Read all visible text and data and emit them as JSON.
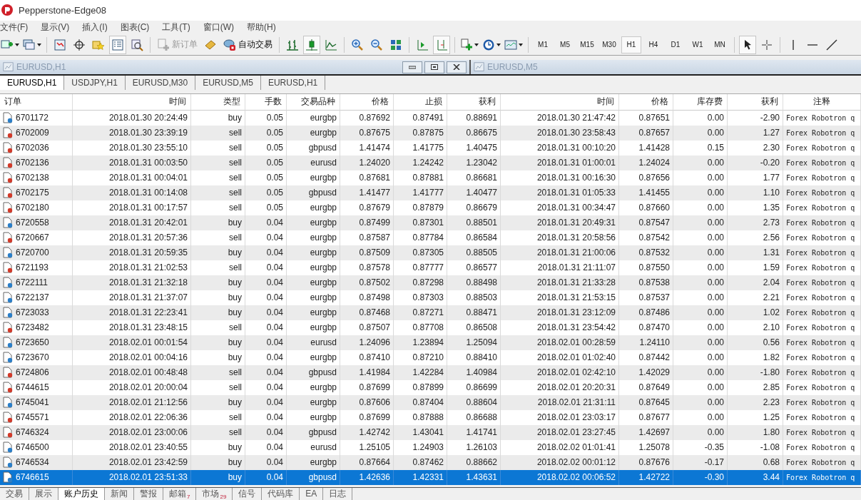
{
  "window": {
    "title": "Pepperstone-Edge08"
  },
  "menu": [
    "文件(F)",
    "显示(V)",
    "插入(I)",
    "图表(C)",
    "工具(T)",
    "窗口(W)",
    "帮助(H)"
  ],
  "toolbar": {
    "new_order": {
      "label": "新订单",
      "disabled": true
    },
    "auto_trading": {
      "label": "自动交易"
    },
    "timeframes": [
      {
        "label": "M1",
        "selected": false
      },
      {
        "label": "M5",
        "selected": false
      },
      {
        "label": "M15",
        "selected": false
      },
      {
        "label": "M30",
        "selected": false
      },
      {
        "label": "H1",
        "selected": true
      },
      {
        "label": "H4",
        "selected": false
      },
      {
        "label": "D1",
        "selected": false
      },
      {
        "label": "W1",
        "selected": false
      },
      {
        "label": "MN",
        "selected": false
      }
    ]
  },
  "minimized_windows": [
    {
      "title": "EURUSD,H1",
      "controls": true
    },
    {
      "title": "EURUSD,M5",
      "controls": false
    }
  ],
  "chart_tabs": [
    {
      "label": "EURUSD,H1",
      "selected": true
    },
    {
      "label": "USDJPY,H1",
      "selected": false
    },
    {
      "label": "EURUSD,M30",
      "selected": false
    },
    {
      "label": "EURUSD,M5",
      "selected": false
    },
    {
      "label": "EURUSD,H1",
      "selected": false
    }
  ],
  "table": {
    "columns": [
      "订单",
      "时间",
      "类型",
      "手数",
      "交易品种",
      "价格",
      "止损",
      "获利",
      "时间",
      "价格",
      "库存费",
      "获利",
      "注释"
    ],
    "rows": [
      {
        "kind": "buy",
        "selected": false,
        "cells": [
          "6701172",
          "2018.01.30 20:24:49",
          "buy",
          "0.05",
          "eurgbp",
          "0.87692",
          "0.87491",
          "0.88691",
          "2018.01.30 21:47:42",
          "0.87651",
          "0.00",
          "-2.90",
          "Forex Robotron q"
        ]
      },
      {
        "kind": "sell",
        "selected": false,
        "cells": [
          "6702009",
          "2018.01.30 23:39:19",
          "sell",
          "0.05",
          "eurgbp",
          "0.87675",
          "0.87875",
          "0.86675",
          "2018.01.30 23:58:43",
          "0.87657",
          "0.00",
          "1.27",
          "Forex Robotron q"
        ]
      },
      {
        "kind": "sell",
        "selected": false,
        "cells": [
          "6702036",
          "2018.01.30 23:55:10",
          "sell",
          "0.05",
          "gbpusd",
          "1.41474",
          "1.41775",
          "1.40475",
          "2018.01.31 00:10:20",
          "1.41428",
          "0.15",
          "2.30",
          "Forex Robotron q"
        ]
      },
      {
        "kind": "sell",
        "selected": false,
        "cells": [
          "6702136",
          "2018.01.31 00:03:50",
          "sell",
          "0.05",
          "eurusd",
          "1.24020",
          "1.24242",
          "1.23042",
          "2018.01.31 01:00:01",
          "1.24024",
          "0.00",
          "-0.20",
          "Forex Robotron q"
        ]
      },
      {
        "kind": "sell",
        "selected": false,
        "cells": [
          "6702138",
          "2018.01.31 00:04:01",
          "sell",
          "0.05",
          "eurgbp",
          "0.87681",
          "0.87881",
          "0.86681",
          "2018.01.31 00:16:30",
          "0.87656",
          "0.00",
          "1.77",
          "Forex Robotron q"
        ]
      },
      {
        "kind": "sell",
        "selected": false,
        "cells": [
          "6702175",
          "2018.01.31 00:14:08",
          "sell",
          "0.05",
          "gbpusd",
          "1.41477",
          "1.41777",
          "1.40477",
          "2018.01.31 01:05:33",
          "1.41455",
          "0.00",
          "1.10",
          "Forex Robotron q"
        ]
      },
      {
        "kind": "sell",
        "selected": false,
        "cells": [
          "6702180",
          "2018.01.31 00:17:57",
          "sell",
          "0.05",
          "eurgbp",
          "0.87679",
          "0.87879",
          "0.86679",
          "2018.01.31 00:34:47",
          "0.87660",
          "0.00",
          "1.35",
          "Forex Robotron q"
        ]
      },
      {
        "kind": "buy",
        "selected": false,
        "cells": [
          "6720558",
          "2018.01.31 20:42:01",
          "buy",
          "0.04",
          "eurgbp",
          "0.87499",
          "0.87301",
          "0.88501",
          "2018.01.31 20:49:31",
          "0.87547",
          "0.00",
          "2.73",
          "Forex Robotron q"
        ]
      },
      {
        "kind": "sell",
        "selected": false,
        "cells": [
          "6720667",
          "2018.01.31 20:57:36",
          "sell",
          "0.04",
          "eurgbp",
          "0.87587",
          "0.87784",
          "0.86584",
          "2018.01.31 20:58:56",
          "0.87542",
          "0.00",
          "2.56",
          "Forex Robotron q"
        ]
      },
      {
        "kind": "buy",
        "selected": false,
        "cells": [
          "6720700",
          "2018.01.31 20:59:35",
          "buy",
          "0.04",
          "eurgbp",
          "0.87509",
          "0.87305",
          "0.88505",
          "2018.01.31 21:00:06",
          "0.87532",
          "0.00",
          "1.31",
          "Forex Robotron q"
        ]
      },
      {
        "kind": "sell",
        "selected": false,
        "cells": [
          "6721193",
          "2018.01.31 21:02:53",
          "sell",
          "0.04",
          "eurgbp",
          "0.87578",
          "0.87777",
          "0.86577",
          "2018.01.31 21:11:07",
          "0.87550",
          "0.00",
          "1.59",
          "Forex Robotron q"
        ]
      },
      {
        "kind": "buy",
        "selected": false,
        "cells": [
          "6722111",
          "2018.01.31 21:32:18",
          "buy",
          "0.04",
          "eurgbp",
          "0.87502",
          "0.87298",
          "0.88498",
          "2018.01.31 21:33:28",
          "0.87538",
          "0.00",
          "2.04",
          "Forex Robotron q"
        ]
      },
      {
        "kind": "buy",
        "selected": false,
        "cells": [
          "6722137",
          "2018.01.31 21:37:07",
          "buy",
          "0.04",
          "eurgbp",
          "0.87498",
          "0.87303",
          "0.88503",
          "2018.01.31 21:53:15",
          "0.87537",
          "0.00",
          "2.21",
          "Forex Robotron q"
        ]
      },
      {
        "kind": "buy",
        "selected": false,
        "cells": [
          "6723033",
          "2018.01.31 22:23:41",
          "buy",
          "0.04",
          "eurgbp",
          "0.87468",
          "0.87271",
          "0.88471",
          "2018.01.31 23:12:09",
          "0.87486",
          "0.00",
          "1.02",
          "Forex Robotron q"
        ]
      },
      {
        "kind": "sell",
        "selected": false,
        "cells": [
          "6723482",
          "2018.01.31 23:48:15",
          "sell",
          "0.04",
          "eurgbp",
          "0.87507",
          "0.87708",
          "0.86508",
          "2018.01.31 23:54:42",
          "0.87470",
          "0.00",
          "2.10",
          "Forex Robotron q"
        ]
      },
      {
        "kind": "buy",
        "selected": false,
        "cells": [
          "6723650",
          "2018.02.01 00:01:54",
          "buy",
          "0.04",
          "eurusd",
          "1.24096",
          "1.23894",
          "1.25094",
          "2018.02.01 00:28:59",
          "1.24110",
          "0.00",
          "0.56",
          "Forex Robotron q"
        ]
      },
      {
        "kind": "buy",
        "selected": false,
        "cells": [
          "6723670",
          "2018.02.01 00:04:16",
          "buy",
          "0.04",
          "eurgbp",
          "0.87410",
          "0.87210",
          "0.88410",
          "2018.02.01 01:02:40",
          "0.87442",
          "0.00",
          "1.82",
          "Forex Robotron q"
        ]
      },
      {
        "kind": "sell",
        "selected": false,
        "cells": [
          "6724806",
          "2018.02.01 00:48:48",
          "sell",
          "0.04",
          "gbpusd",
          "1.41984",
          "1.42284",
          "1.40984",
          "2018.02.01 02:42:10",
          "1.42029",
          "0.00",
          "-1.80",
          "Forex Robotron q"
        ]
      },
      {
        "kind": "sell",
        "selected": false,
        "cells": [
          "6744615",
          "2018.02.01 20:00:04",
          "sell",
          "0.04",
          "eurgbp",
          "0.87699",
          "0.87899",
          "0.86699",
          "2018.02.01 20:20:31",
          "0.87649",
          "0.00",
          "2.85",
          "Forex Robotron q"
        ]
      },
      {
        "kind": "buy",
        "selected": false,
        "cells": [
          "6745041",
          "2018.02.01 21:12:56",
          "buy",
          "0.04",
          "eurgbp",
          "0.87606",
          "0.87404",
          "0.88604",
          "2018.02.01 21:31:11",
          "0.87645",
          "0.00",
          "2.23",
          "Forex Robotron q"
        ]
      },
      {
        "kind": "sell",
        "selected": false,
        "cells": [
          "6745571",
          "2018.02.01 22:06:36",
          "sell",
          "0.04",
          "eurgbp",
          "0.87699",
          "0.87888",
          "0.86688",
          "2018.02.01 23:03:17",
          "0.87677",
          "0.00",
          "1.25",
          "Forex Robotron q"
        ]
      },
      {
        "kind": "sell",
        "selected": false,
        "cells": [
          "6746324",
          "2018.02.01 23:00:06",
          "sell",
          "0.04",
          "gbpusd",
          "1.42742",
          "1.43041",
          "1.41741",
          "2018.02.01 23:27:45",
          "1.42697",
          "0.00",
          "1.80",
          "Forex Robotron q"
        ]
      },
      {
        "kind": "buy",
        "selected": false,
        "cells": [
          "6746500",
          "2018.02.01 23:40:55",
          "buy",
          "0.04",
          "eurusd",
          "1.25105",
          "1.24903",
          "1.26103",
          "2018.02.02 01:01:41",
          "1.25078",
          "-0.35",
          "-1.08",
          "Forex Robotron q"
        ]
      },
      {
        "kind": "buy",
        "selected": false,
        "cells": [
          "6746534",
          "2018.02.01 23:42:59",
          "buy",
          "0.04",
          "eurgbp",
          "0.87664",
          "0.87462",
          "0.88662",
          "2018.02.02 00:01:12",
          "0.87676",
          "-0.17",
          "0.68",
          "Forex Robotron q"
        ]
      },
      {
        "kind": "buy",
        "selected": true,
        "cells": [
          "6746615",
          "2018.02.01 23:51:33",
          "buy",
          "0.04",
          "gbpusd",
          "1.42636",
          "1.42331",
          "1.43631",
          "2018.02.02 00:06:52",
          "1.42722",
          "-0.30",
          "3.44",
          "Forex Robotron q"
        ]
      }
    ]
  },
  "bottom_tabs": [
    {
      "label": "交易",
      "selected": false
    },
    {
      "label": "展示",
      "selected": false
    },
    {
      "label": "账户历史",
      "selected": true
    },
    {
      "label": "新闻",
      "selected": false
    },
    {
      "label": "警报",
      "selected": false
    },
    {
      "label": "邮箱",
      "badge": "7",
      "selected": false
    },
    {
      "label": "市场",
      "badge": "29",
      "selected": false
    },
    {
      "label": "信号",
      "selected": false
    },
    {
      "label": "代码库",
      "selected": false
    },
    {
      "label": "EA",
      "selected": false
    },
    {
      "label": "日志",
      "selected": false
    }
  ]
}
